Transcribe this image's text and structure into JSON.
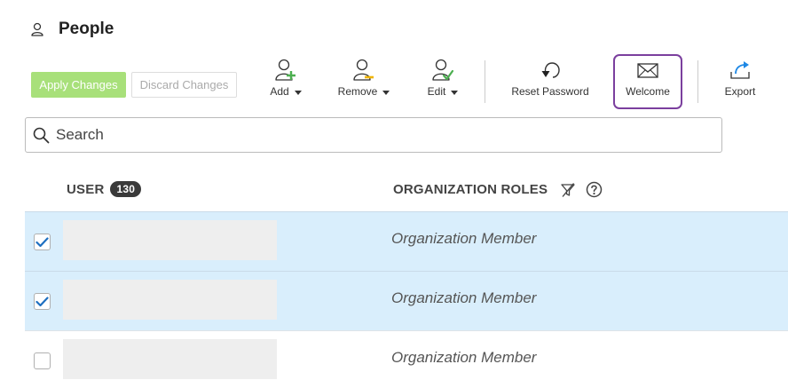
{
  "page": {
    "title": "People"
  },
  "actions": {
    "apply_label": "Apply Changes",
    "discard_label": "Discard Changes"
  },
  "toolbar": [
    {
      "key": "add",
      "label": "Add",
      "icon": "user-add-icon",
      "dropdown": true
    },
    {
      "key": "remove",
      "label": "Remove",
      "icon": "user-remove-icon",
      "dropdown": true
    },
    {
      "key": "edit",
      "label": "Edit",
      "icon": "user-edit-icon",
      "dropdown": true
    },
    {
      "key": "reset_password",
      "label": "Reset Password",
      "icon": "reset-password-icon",
      "dropdown": false
    },
    {
      "key": "welcome",
      "label": "Welcome",
      "icon": "envelope-icon",
      "dropdown": false,
      "highlighted": true
    },
    {
      "key": "export",
      "label": "Export",
      "icon": "export-icon",
      "dropdown": false
    }
  ],
  "search": {
    "placeholder": "Search",
    "value": ""
  },
  "table": {
    "columns": {
      "user": "USER",
      "user_count": "130",
      "roles": "ORGANIZATION ROLES"
    },
    "rows": [
      {
        "checked": true,
        "role": "Organization Member"
      },
      {
        "checked": true,
        "role": "Organization Member"
      },
      {
        "checked": false,
        "role": "Organization Member"
      }
    ]
  },
  "colors": {
    "apply_bg": "#a8e07a",
    "highlight_border": "#7b3f9e",
    "selected_row_bg": "#d9eefc",
    "add_icon_accent": "#4caf50",
    "remove_icon_accent": "#f0b400",
    "edit_icon_accent": "#4caf50",
    "export_icon_accent": "#1e88e5",
    "checkbox_check": "#1e6fc0"
  }
}
